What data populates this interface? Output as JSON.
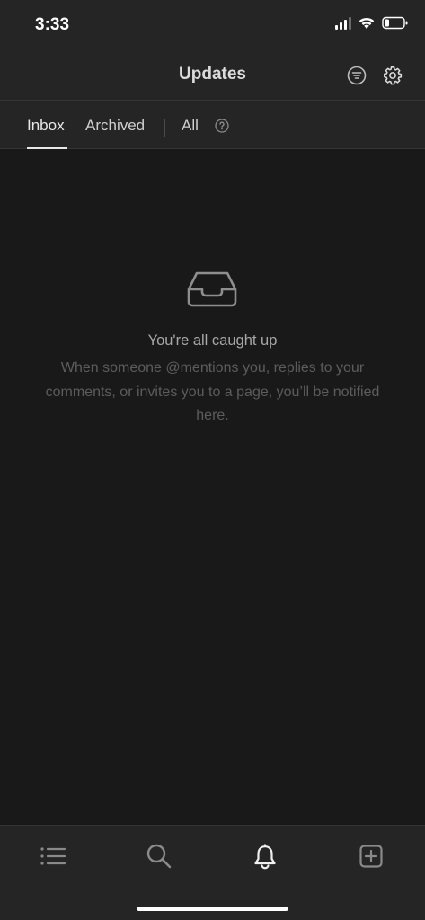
{
  "status_bar": {
    "time": "3:33"
  },
  "header": {
    "title": "Updates",
    "filter_icon": "filter-icon",
    "settings_icon": "gear-icon"
  },
  "tabs": {
    "items": [
      {
        "label": "Inbox",
        "active": true
      },
      {
        "label": "Archived",
        "active": false
      },
      {
        "label": "All",
        "active": false
      }
    ],
    "help_icon": "help-circle-icon"
  },
  "empty_state": {
    "icon": "inbox-tray-icon",
    "title": "You're all caught up",
    "description": "When someone @mentions you, replies to your comments, or invites you to a page, you’ll be notified here."
  },
  "bottom_nav": {
    "items": [
      {
        "icon": "list-icon",
        "active": false
      },
      {
        "icon": "search-icon",
        "active": false
      },
      {
        "icon": "bell-icon",
        "active": true
      },
      {
        "icon": "new-page-icon",
        "active": false
      }
    ]
  },
  "colors": {
    "background": "#191919",
    "surface": "#252525",
    "text_primary": "#e6e6e6",
    "text_muted": "#5c5c5c"
  }
}
